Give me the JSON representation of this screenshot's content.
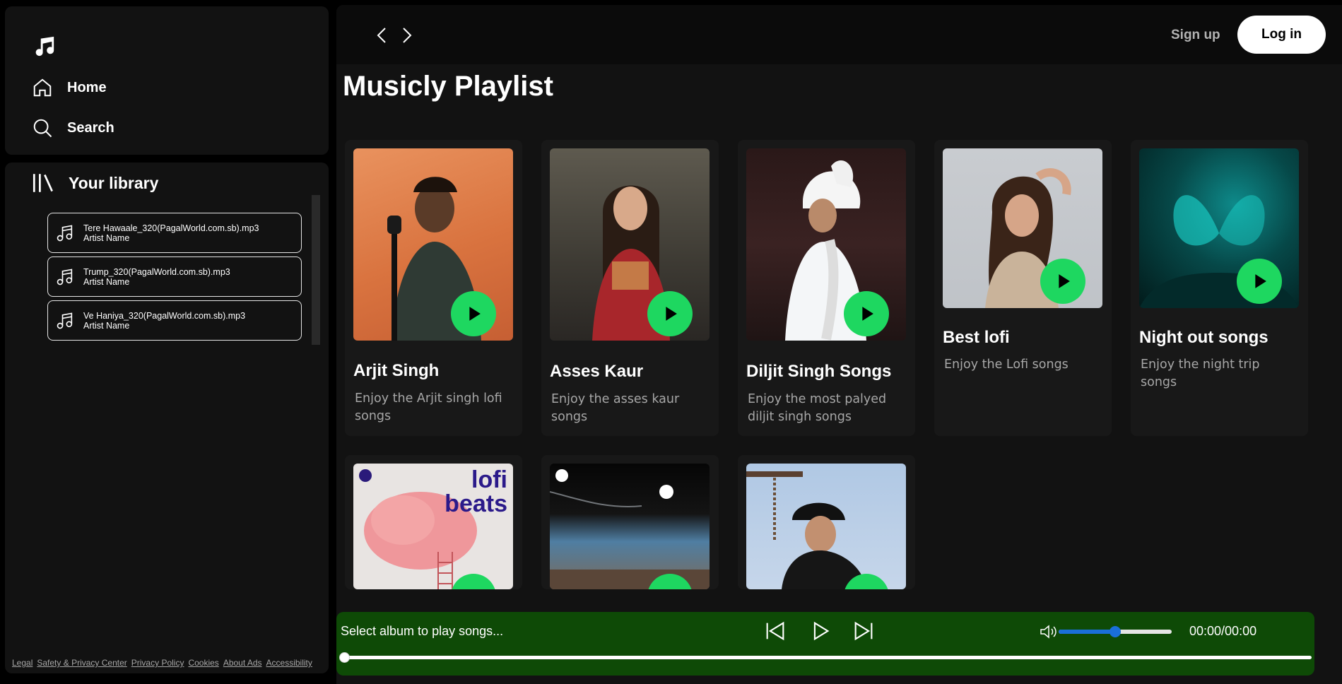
{
  "nav": {
    "home_label": "Home",
    "search_label": "Search"
  },
  "library": {
    "title": "Your library",
    "songs": [
      {
        "title": "Tere Hawaale_320(PagalWorld.com.sb).mp3",
        "artist": "Artist Name"
      },
      {
        "title": "Trump_320(PagalWorld.com.sb).mp3",
        "artist": "Artist Name"
      },
      {
        "title": "Ve Haniya_320(PagalWorld.com.sb).mp3",
        "artist": "Artist Name"
      }
    ],
    "footer_links": [
      "Legal",
      "Safety & Privacy Center",
      "Privacy Policy",
      "Cookies",
      "About Ads",
      "Accessibility"
    ]
  },
  "header": {
    "signup_label": "Sign up",
    "login_label": "Log in"
  },
  "main": {
    "title": "Musicly Playlist",
    "cards": [
      {
        "title": "Arjit Singh",
        "desc": "Enjoy the Arjit singh lofi songs",
        "art": "portrait-singer-guitar"
      },
      {
        "title": "Asses Kaur",
        "desc": "Enjoy the asses kaur songs",
        "art": "portrait-singer-red-dress"
      },
      {
        "title": "Diljit Singh Songs",
        "desc": "Enjoy the most palyed diljit singh songs",
        "art": "portrait-singer-turban"
      },
      {
        "title": "Best lofi",
        "desc": "Enjoy the Lofi songs",
        "art": "portrait-singer-pose"
      },
      {
        "title": "Night out songs",
        "desc": "Enjoy the night trip songs",
        "art": "butterfly-teal"
      },
      {
        "title": "",
        "desc": "",
        "art": "lofi-beats-cover",
        "cover_text_1": "lofi",
        "cover_text_2": "beats"
      },
      {
        "title": "",
        "desc": "",
        "art": "beach-sunset"
      },
      {
        "title": "",
        "desc": "",
        "art": "portrait-singer-black-turban"
      }
    ]
  },
  "player": {
    "status": "Select album to play songs...",
    "time": "00:00/00:00",
    "volume_fraction": 0.5,
    "progress_fraction": 0,
    "colors": {
      "bar": "#0e4a06",
      "accent": "#1ed760",
      "volume": "#1a6fd8"
    }
  }
}
